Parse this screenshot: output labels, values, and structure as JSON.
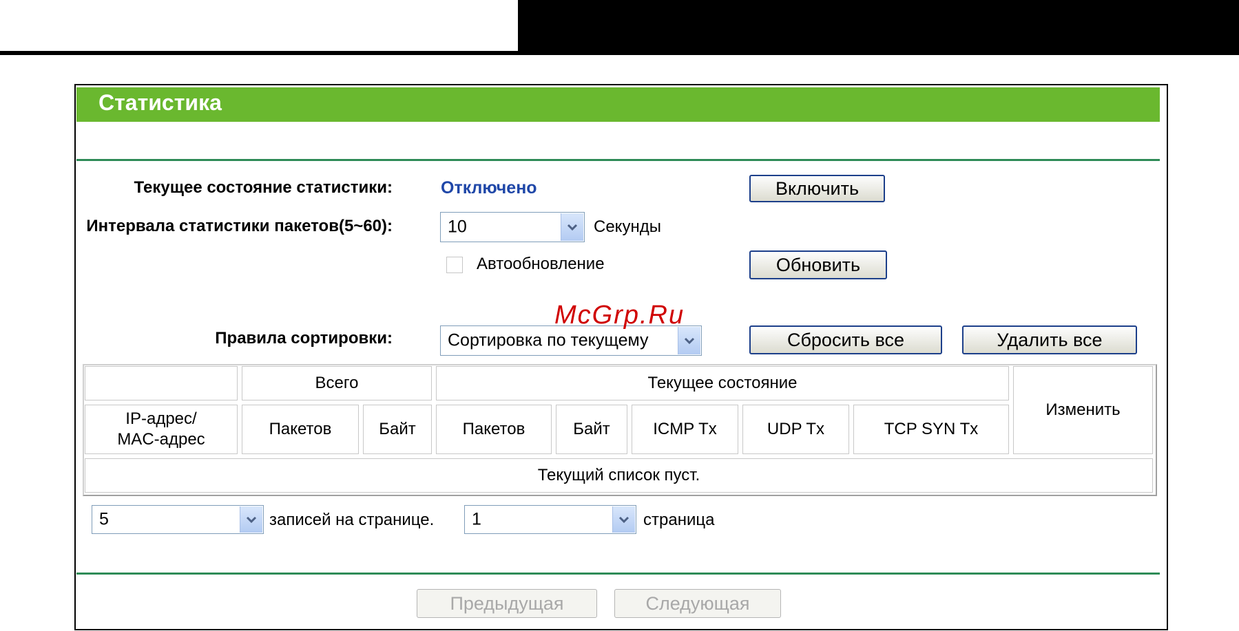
{
  "title": "Статистика",
  "current_state": {
    "label": "Текущее состояние статистики:",
    "value": "Отключено",
    "enable_button": "Включить"
  },
  "interval": {
    "label": "Интервала статистики пакетов(5~60):",
    "value": "10",
    "unit": "Секунды"
  },
  "auto_refresh": {
    "label": "Автообновление",
    "checked": false,
    "refresh_button": "Обновить"
  },
  "sort": {
    "label": "Правила сортировки:",
    "value": "Сортировка по текущему",
    "reset_all_button": "Сбросить все",
    "delete_all_button": "Удалить все"
  },
  "table": {
    "group_total": "Всего",
    "group_current": "Текущее состояние",
    "col_edit": "Изменить",
    "col_ip_mac": "IP-адрес/\nMAC-адрес",
    "col_packets": "Пакетов",
    "col_bytes": "Байт",
    "col_packets2": "Пакетов",
    "col_bytes2": "Байт",
    "col_icmp": "ICMP Tx",
    "col_udp": "UDP Tx",
    "col_tcp_syn": "TCP SYN Tx",
    "empty_text": "Текущий список пуст."
  },
  "pagination": {
    "per_page_value": "5",
    "per_page_label": "записей на странице.",
    "page_value": "1",
    "page_label": "страница",
    "prev_button": "Предыдущая",
    "next_button": "Следующая"
  },
  "watermark": "McGrp.Ru",
  "colors": {
    "title_bar": "#6ab82f",
    "status_text": "#1f47a8",
    "divider": "#2e8b57",
    "watermark": "#d00000"
  }
}
